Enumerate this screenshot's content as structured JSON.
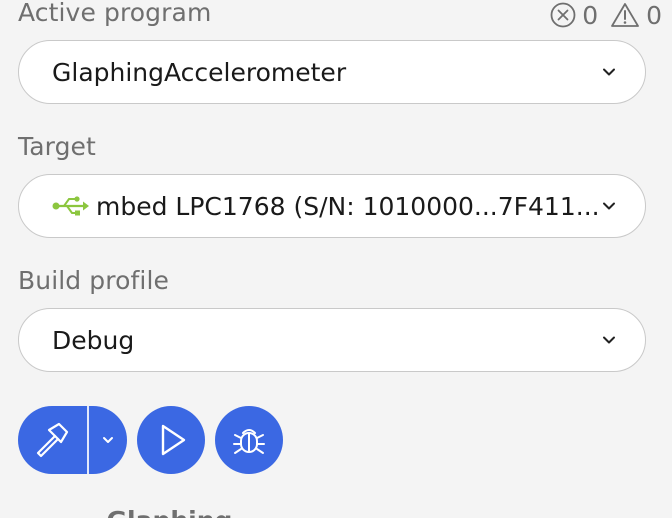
{
  "header": {
    "active_program_label": "Active program",
    "error_count": "0",
    "warning_count": "0"
  },
  "active_program": {
    "selected": "GlaphingAccelerometer"
  },
  "target": {
    "label": "Target",
    "selected": "mbed LPC1768 (S/N: 1010000...7F411...",
    "connection_icon": "usb-icon",
    "connection_color": "#8cc63f"
  },
  "build_profile": {
    "label": "Build profile",
    "selected": "Debug"
  },
  "actions": {
    "build_icon": "hammer-icon",
    "build_dropdown_icon": "chevron-down-icon",
    "run_icon": "play-icon",
    "debug_icon": "bug-icon",
    "accent_color": "#3b68e3"
  },
  "below": {
    "partial_text": "...Glaphing..."
  }
}
